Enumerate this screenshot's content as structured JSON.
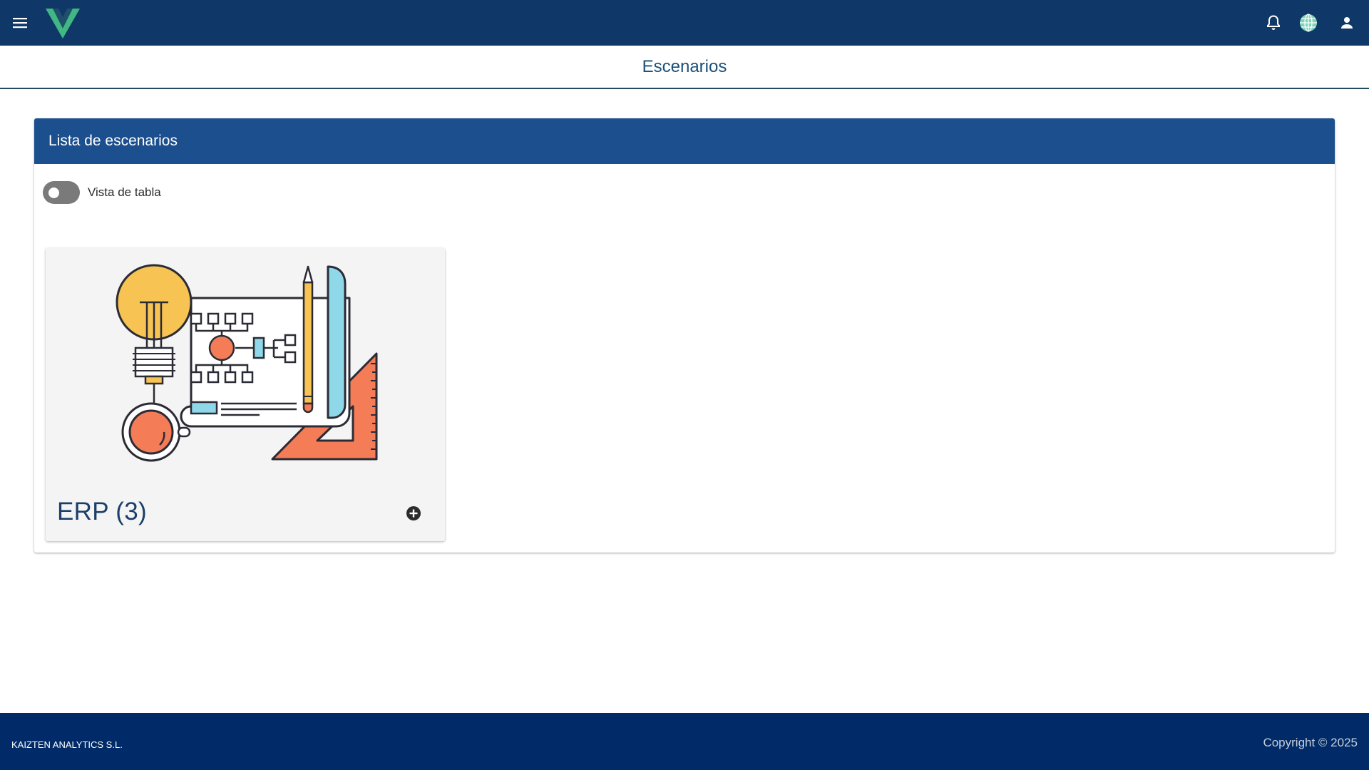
{
  "appbar": {
    "menu_icon": "menu-icon",
    "logo_icon": "vue-logo-icon",
    "notification_icon": "bell-icon",
    "language_icon": "globe-icon",
    "account_icon": "account-icon"
  },
  "page": {
    "title": "Escenarios"
  },
  "scenarios_card": {
    "header": "Lista de escenarios",
    "table_view_toggle": {
      "label": "Vista de tabla",
      "checked": false
    },
    "tiles": [
      {
        "title": "ERP (3)",
        "illustration_icon": "blueprint-idea-illustration",
        "action_icon": "add-circle-icon"
      }
    ]
  },
  "footer": {
    "company": "KAIZTEN ANALYTICS S.L.",
    "copyright": "Copyright © 2025"
  },
  "colors": {
    "appbar": "#0f3868",
    "card_header": "#1c4f8e",
    "footer": "#012b68",
    "title_text": "#1b4f78"
  }
}
